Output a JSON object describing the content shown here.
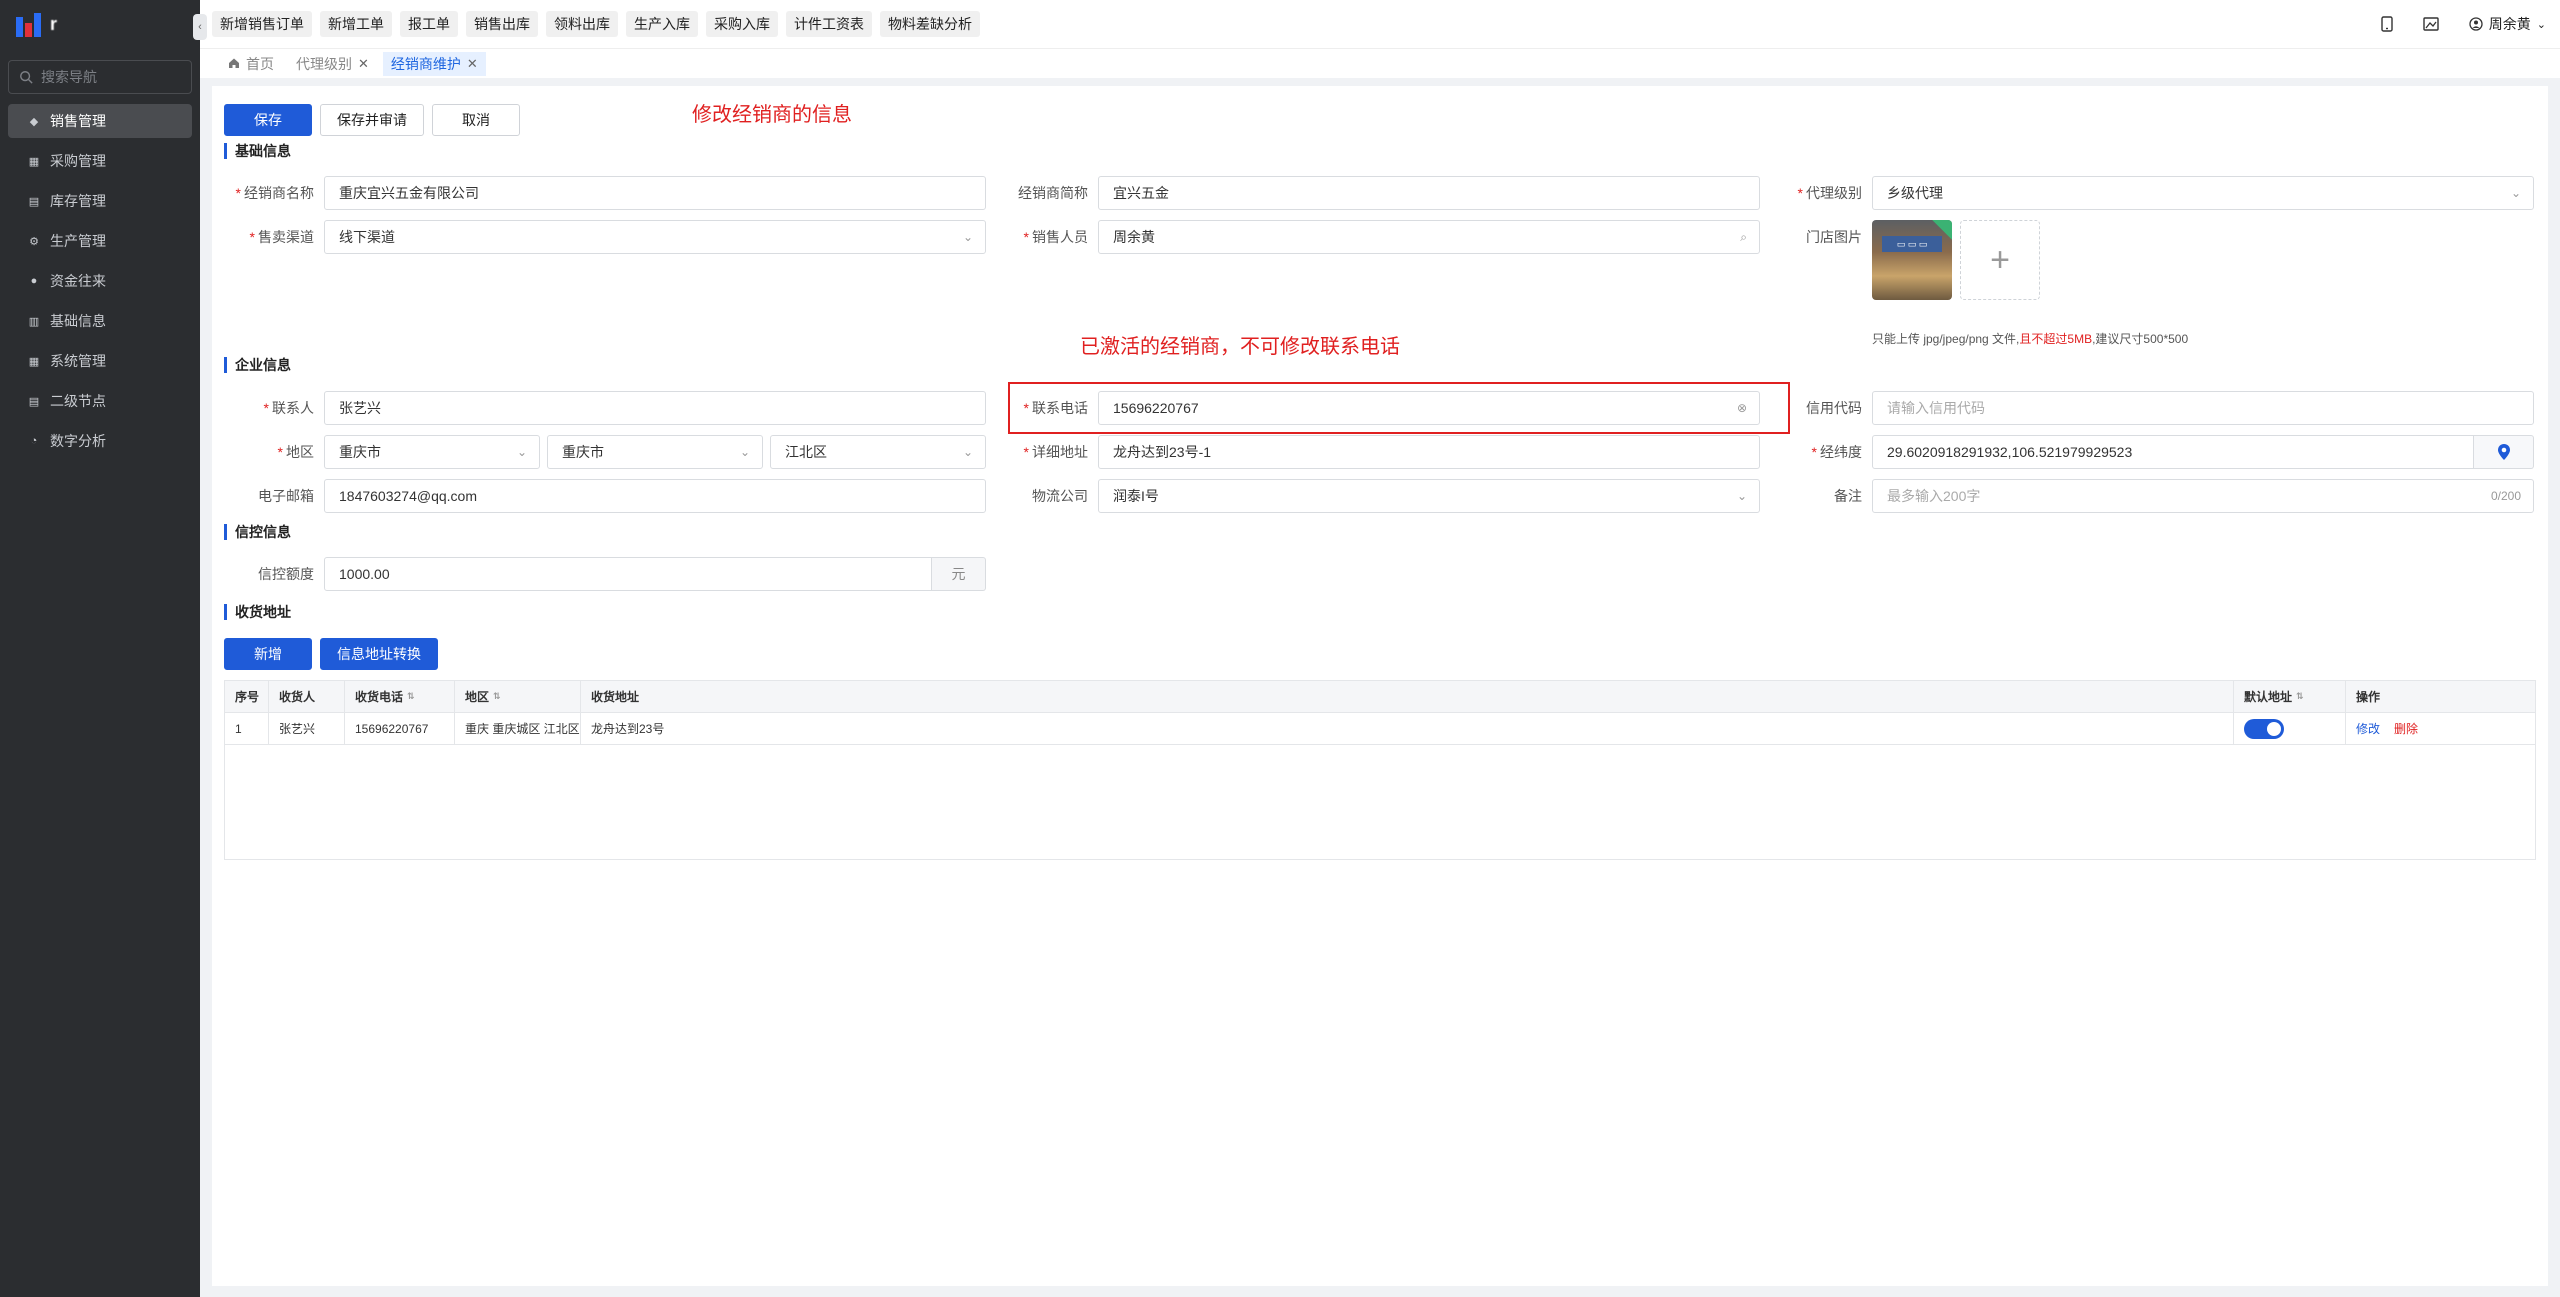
{
  "app": {
    "logo_text": "r"
  },
  "sidebar": {
    "search_placeholder": "搜索导航",
    "items": [
      {
        "label": "销售管理",
        "icon": "tag-icon",
        "glyph": "◆",
        "active": true
      },
      {
        "label": "采购管理",
        "icon": "cart-icon",
        "glyph": "▦"
      },
      {
        "label": "库存管理",
        "icon": "inventory-icon",
        "glyph": "▤"
      },
      {
        "label": "生产管理",
        "icon": "production-icon",
        "glyph": "⚙"
      },
      {
        "label": "资金往来",
        "icon": "money-icon",
        "glyph": "●"
      },
      {
        "label": "基础信息",
        "icon": "base-info-icon",
        "glyph": "▥"
      },
      {
        "label": "系统管理",
        "icon": "system-icon",
        "glyph": "▦"
      },
      {
        "label": "二级节点",
        "icon": "node-icon",
        "glyph": "▤"
      },
      {
        "label": "数字分析",
        "icon": "analysis-icon",
        "glyph": "◔"
      }
    ]
  },
  "topbar": {
    "quick_links": [
      "新增销售订单",
      "新增工单",
      "报工单",
      "销售出库",
      "领料出库",
      "生产入库",
      "采购入库",
      "计件工资表",
      "物料差缺分析"
    ],
    "user_name": "周余黄"
  },
  "tabs": [
    {
      "label": "首页",
      "icon": "home-icon"
    },
    {
      "label": "代理级别",
      "closable": true
    },
    {
      "label": "经销商维护",
      "closable": true,
      "active": true
    }
  ],
  "toolbar": {
    "save": "保存",
    "save_approve": "保存并审请",
    "cancel": "取消"
  },
  "annotations": {
    "edit_note": "修改经销商的信息",
    "phone_note": "已激活的经销商，不可修改联系电话"
  },
  "basic": {
    "section_title": "基础信息",
    "dealer_name_label": "经销商名称",
    "dealer_name": "重庆宜兴五金有限公司",
    "short_name_label": "经销商简称",
    "short_name": "宜兴五金",
    "agent_level_label": "代理级别",
    "agent_level": "乡级代理",
    "channel_label": "售卖渠道",
    "channel": "线下渠道",
    "salesperson_label": "销售人员",
    "salesperson": "周余黄",
    "store_photo_label": "门店图片",
    "upload_hint_prefix": "只能上传 jpg/jpeg/png 文件,",
    "upload_hint_red": "且不超过5MB",
    "upload_hint_suffix": ",建议尺寸500*500"
  },
  "enterprise": {
    "section_title": "企业信息",
    "contact_label": "联系人",
    "contact": "张艺兴",
    "phone_label": "联系电话",
    "phone": "15696220767",
    "credit_code_label": "信用代码",
    "credit_code_placeholder": "请输入信用代码",
    "region_label": "地区",
    "province": "重庆市",
    "city": "重庆市",
    "district": "江北区",
    "address_label": "详细地址",
    "address": "龙舟达到23号-1",
    "coords_label": "经纬度",
    "coords": "29.6020918291932,106.521979929523",
    "email_label": "电子邮箱",
    "email": "1847603274@qq.com",
    "logistics_label": "物流公司",
    "logistics": "润泰I号",
    "remark_label": "备注",
    "remark_placeholder": "最多输入200字",
    "remark_count": "0/200"
  },
  "credit": {
    "section_title": "信控信息",
    "limit_label": "信控额度",
    "limit": "1000.00",
    "unit": "元"
  },
  "shipping": {
    "section_title": "收货地址",
    "add_button": "新增",
    "convert_button": "信息地址转换",
    "columns": [
      "序号",
      "收货人",
      "收货电话",
      "地区",
      "收货地址",
      "默认地址",
      "操作"
    ],
    "rows": [
      {
        "index": "1",
        "receiver": "张艺兴",
        "phone": "15696220767",
        "region": "重庆 重庆城区 江北区",
        "address": "龙舟达到23号",
        "default": true,
        "edit": "修改",
        "delete": "删除"
      }
    ]
  }
}
